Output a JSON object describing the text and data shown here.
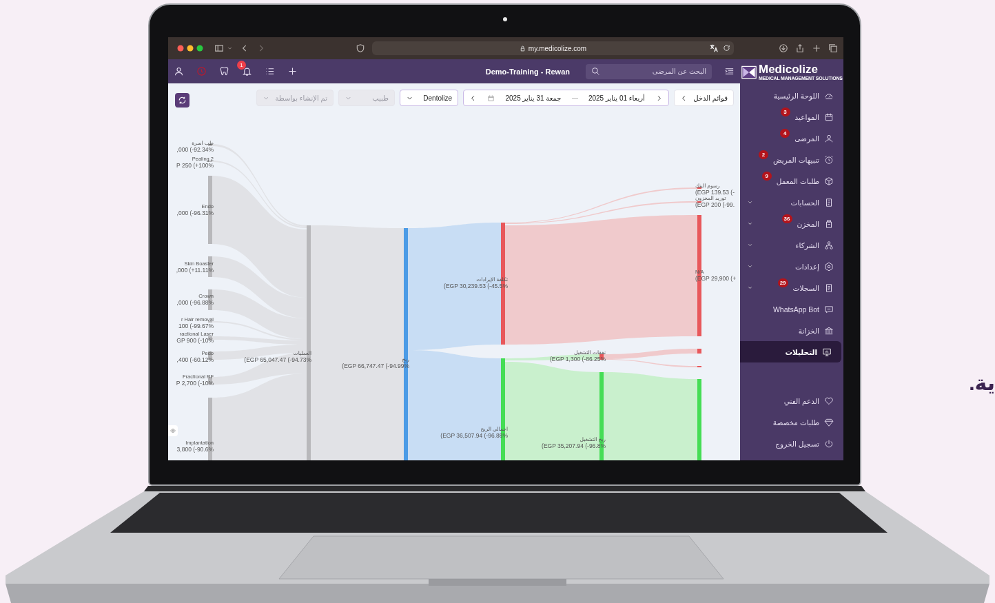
{
  "browser": {
    "url": "my.medicolize.com"
  },
  "topbar": {
    "title": "Demo-Training - Rewan",
    "notification_badge": "1",
    "search": {
      "placeholder": "البحث عن المرضى"
    }
  },
  "filters": {
    "report_button": "قوائم الدخل",
    "date_from": "أربعاء 01 يناير 2025",
    "date_to": "جمعة 31 يناير 2025",
    "dropdowns": [
      {
        "value": "Dentolize",
        "disabled": false
      },
      {
        "placeholder": "طبيب",
        "disabled": true
      },
      {
        "placeholder": "تم الإنشاء بواسطة",
        "disabled": true
      }
    ]
  },
  "sidebar": {
    "logo": "Medicolize",
    "tagline": "MEDICAL MANAGEMENT SOLUTIONS",
    "items": [
      {
        "label": "اللوحة الرئيسية",
        "kind": "link",
        "selected": false
      },
      {
        "label": "المواعيد",
        "badge": "3",
        "kind": "link",
        "selected": false
      },
      {
        "label": "المرضى",
        "badge": "4",
        "kind": "link",
        "selected": false
      },
      {
        "label": "تنبيهات المريض",
        "badge": "2",
        "kind": "link",
        "selected": false
      },
      {
        "label": "طلبات المعمل",
        "badge": "9",
        "kind": "link",
        "selected": false
      },
      {
        "label": "الحسابات",
        "kind": "group",
        "selected": false
      },
      {
        "label": "المخزن",
        "badge": "36",
        "kind": "group",
        "selected": false
      },
      {
        "label": "الشركاء",
        "kind": "group",
        "selected": false
      },
      {
        "label": "إعدادات",
        "kind": "group",
        "selected": false
      },
      {
        "label": "السجلات",
        "badge": "29",
        "kind": "group",
        "selected": false
      },
      {
        "label": "WhatsApp Bot",
        "kind": "link",
        "selected": false
      },
      {
        "label": "الخزانة",
        "kind": "link",
        "selected": false
      },
      {
        "label": "التحليلات",
        "kind": "link",
        "selected": true
      }
    ],
    "footer_items": [
      {
        "label": "الدعم الفني"
      },
      {
        "label": "طلبات مخصصة"
      },
      {
        "label": "تسجيل الخروج"
      }
    ]
  },
  "sankey": {
    "nodes": [
      {
        "label": "طب اسرة",
        "value": ",000 (-92.34%",
        "color": "#b8b8bb"
      },
      {
        "label": "Pealing 2",
        "value": "P 250 (+100%",
        "color": "#b8b8bb"
      },
      {
        "label": "Endo",
        "value": ",000 (-96.31%",
        "color": "#b8b8bb"
      },
      {
        "label": "Skin Boaster",
        "value": ",000 (+11.11%",
        "color": "#b8b8bb"
      },
      {
        "label": "Crown",
        "value": ",000 (-96.88%",
        "color": "#b8b8bb"
      },
      {
        "label": "r Hair removal",
        "value": "100 (-99.67%",
        "color": "#b8b8bb"
      },
      {
        "label": "ractional Laser",
        "value": "GP 900 (-10%",
        "color": "#b8b8bb"
      },
      {
        "label": "Pedo",
        "value": ",400 (-60.12%",
        "color": "#b8b8bb"
      },
      {
        "label": "Fractional RF",
        "value": "P 2,700 (-10%",
        "color": "#b8b8bb"
      },
      {
        "label": "Implantation",
        "value": "3,800 (-90.6%",
        "color": "#b8b8bb"
      },
      {
        "label": "العمليات",
        "value": "(EGP 65,047.47 (-94.73%",
        "color": "#b8b8bb"
      },
      {
        "label": "ربح",
        "value": "(EGP 66,747.47 (-94.99%",
        "color": "#4b9be6"
      },
      {
        "label": "تكلفة الإيرادات",
        "value": "(EGP 30,239.53 (-45.5%",
        "color": "#e8585b"
      },
      {
        "label": "اجمالي الربح",
        "value": "(EGP 36,507.94 (-96.88%",
        "color": "#45dd55"
      },
      {
        "label": "نفقات التشغيل",
        "value": "(EGP 1,300 (-86.25%",
        "color": "#e8585b"
      },
      {
        "label": "ربح التشغيل",
        "value": "(EGP 35,207.94 (-96.8%",
        "color": "#45dd55"
      },
      {
        "label": "رسوم البنك",
        "value": "(EGP 139.53 (-",
        "color": "#e8585b"
      },
      {
        "label": "توريد المخزون",
        "value": "(EGP 200 (-99.",
        "color": "#e8585b"
      },
      {
        "label": "N/A",
        "value": "(EGP 29,900 (+",
        "color": "#e8585b"
      },
      {
        "color": "#e8585b"
      },
      {
        "color": "#e8585b"
      },
      {
        "color": "#45dd55"
      }
    ]
  },
  "marketing_text": "ية."
}
